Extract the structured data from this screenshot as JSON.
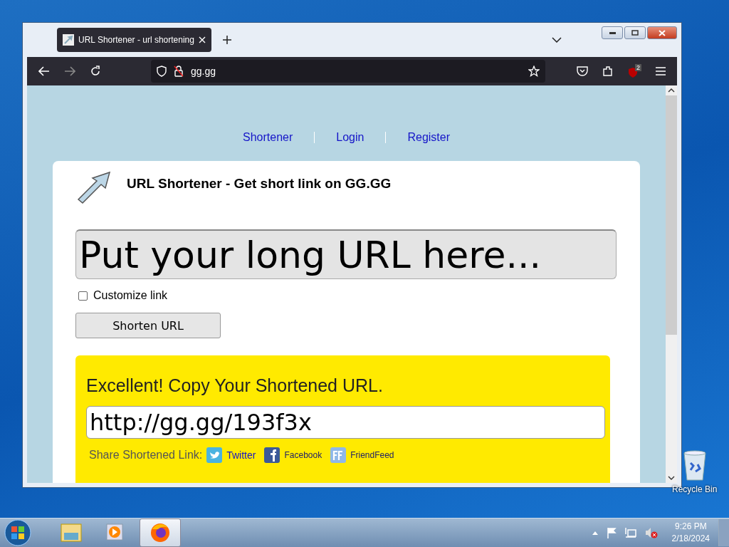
{
  "browser": {
    "tabs": [
      {
        "title": "URL Shortener - url shortening",
        "selected": true
      }
    ],
    "address": "gg.gg",
    "extension_badge": "2"
  },
  "page": {
    "nav": [
      {
        "label": "Shortener"
      },
      {
        "label": "Login"
      },
      {
        "label": "Register"
      }
    ],
    "title": "URL Shortener - Get short link on GG.GG",
    "url_input": {
      "placeholder": "Put your long URL here..."
    },
    "customize": {
      "label": "Customize link",
      "checked": false
    },
    "submit": "Shorten URL",
    "result": {
      "heading": "Excellent! Copy Your Shortened URL.",
      "short_url": "http://gg.gg/193f3x",
      "share_label": "Share Shortened Link:",
      "share_links": [
        {
          "label": "Twitter",
          "kind": "twitter"
        },
        {
          "label": "Facebook",
          "kind": "facebook"
        },
        {
          "label": "FriendFeed",
          "kind": "friendfeed"
        }
      ]
    }
  },
  "desktop": {
    "icons": [
      {
        "label": "Recycle Bin"
      }
    ]
  },
  "taskbar": {
    "apps": [
      {
        "kind": "explorer",
        "active": false
      },
      {
        "kind": "media",
        "active": false
      },
      {
        "kind": "firefox",
        "active": true
      }
    ],
    "time": "9:26 PM",
    "date": "2/18/2024"
  }
}
